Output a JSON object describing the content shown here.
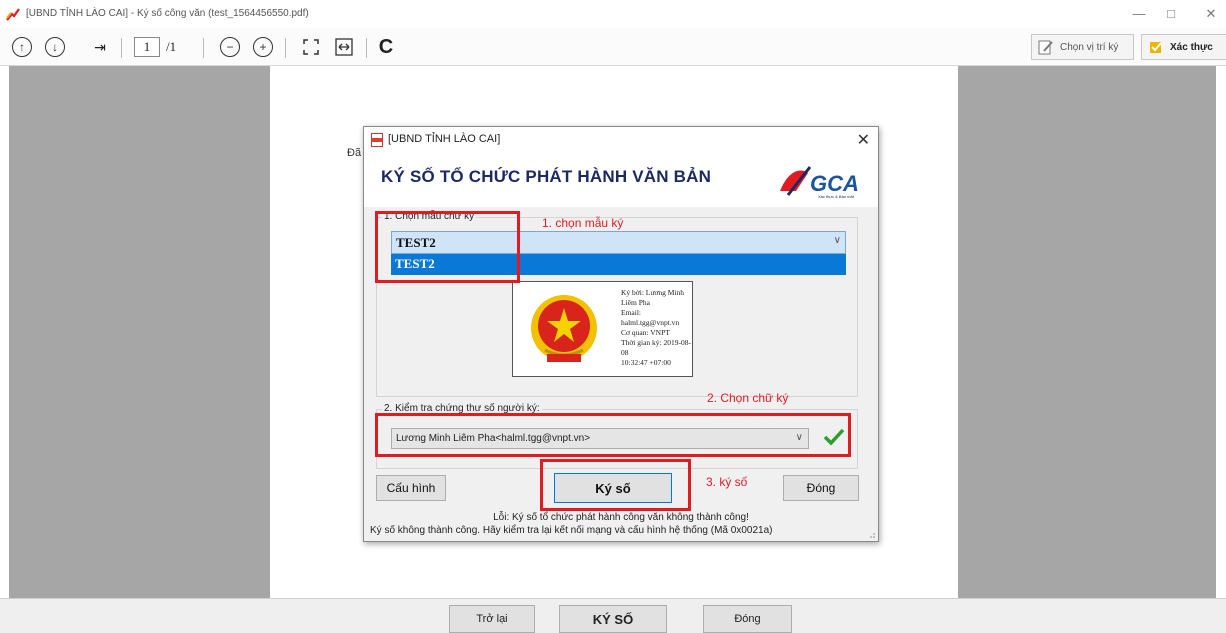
{
  "window": {
    "title": "[UBND TỈNH LÀO CAI] - Ký số công văn (test_1564456550.pdf)",
    "minimize": "—",
    "maximize": "□",
    "close": "✕"
  },
  "toolbar": {
    "page_current": "1",
    "page_total": "/1",
    "btn_choose_position": "Chọn vị trí ký",
    "btn_verify": "Xác thực"
  },
  "page": {
    "fragment": "Đã"
  },
  "dialog": {
    "title": "[UBND TỈNH LÀO CAI]",
    "heading": "KÝ SỐ TỔ CHỨC PHÁT HÀNH VĂN BẢN",
    "logo_text": "GCA",
    "logo_sub": "Xác thực & Bảo mật",
    "group1_label": "1. Chọn mẫu chữ ký",
    "template_selected": "TEST2",
    "template_option": "TEST2",
    "signature_preview": {
      "line1": "Ký bởi: Lương Minh Liêm Pha",
      "line2": "Email: halml.tgg@vnpt.vn",
      "line3": "Cơ quan: VNPT",
      "line4": "Thời gian ký: 2019-08-08",
      "line5": "10:32:47 +07:00"
    },
    "group2_label": "2. Kiểm tra chứng thư số người ký:",
    "certificate_selected": "Lương Minh Liêm Pha<halml.tgg@vnpt.vn>",
    "btn_config": "Cấu hình",
    "btn_sign": "Ký số",
    "btn_close": "Đóng",
    "error_line1": "Lỗi: Ký số tổ chức phát hành công văn không thành công!",
    "error_line2": "Ký số không thành công. Hãy kiểm tra lại kết nối mạng và cấu hình hệ thống (Mã 0x0021a)"
  },
  "annotations": {
    "step1": "1. chọn mẫu ký",
    "step2": "2. Chọn chữ ký",
    "step3": "3. ký số",
    "color": "#e21b22"
  },
  "bottom": {
    "btn_back": "Trở lại",
    "btn_sign": "KÝ SỐ",
    "btn_close": "Đóng"
  },
  "icons": [
    "app-icon",
    "arrow-up-icon",
    "arrow-down-icon",
    "last-page-icon",
    "zoom-out-icon",
    "zoom-in-icon",
    "fit-page-icon",
    "fit-width-icon",
    "rotate-icon",
    "edit-position-icon",
    "verify-icon",
    "pdf-icon",
    "close-icon",
    "check-icon",
    "resize-grip-icon"
  ]
}
